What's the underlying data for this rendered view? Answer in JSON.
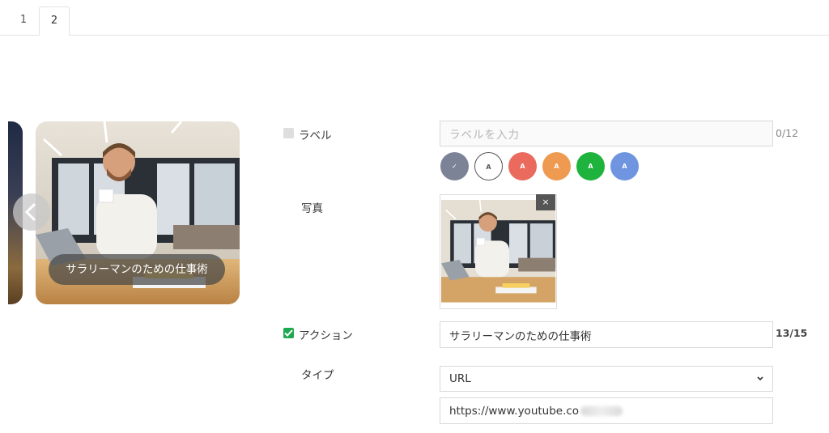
{
  "tabs": [
    {
      "label": "1",
      "active": false
    },
    {
      "label": "2",
      "active": true
    }
  ],
  "card": {
    "label": "サラリーマンのための仕事術"
  },
  "form": {
    "label_field": {
      "title": "ラベル",
      "checked": false,
      "placeholder": "ラベルを入力",
      "value": "",
      "counter": "0/12"
    },
    "swatches": [
      {
        "text": "✓",
        "color": "#7c8396",
        "selected": true
      },
      {
        "text": "A",
        "color": "#ffffff",
        "selected": false
      },
      {
        "text": "A",
        "color": "#ea6a5e",
        "selected": false
      },
      {
        "text": "A",
        "color": "#ee9a50",
        "selected": false
      },
      {
        "text": "A",
        "color": "#1db33c",
        "selected": false
      },
      {
        "text": "A",
        "color": "#6f95e0",
        "selected": false
      }
    ],
    "photo": {
      "title": "写真",
      "close": "×"
    },
    "action": {
      "title": "アクション",
      "checked": true,
      "value": "サラリーマンのための仕事術",
      "counter": "13/15"
    },
    "type": {
      "title": "タイプ",
      "selected": "URL",
      "url_value": "https://www.youtube.co"
    }
  },
  "colors": {
    "checkbox_on": "#1ea850",
    "checkbox_off": "#dedede"
  }
}
